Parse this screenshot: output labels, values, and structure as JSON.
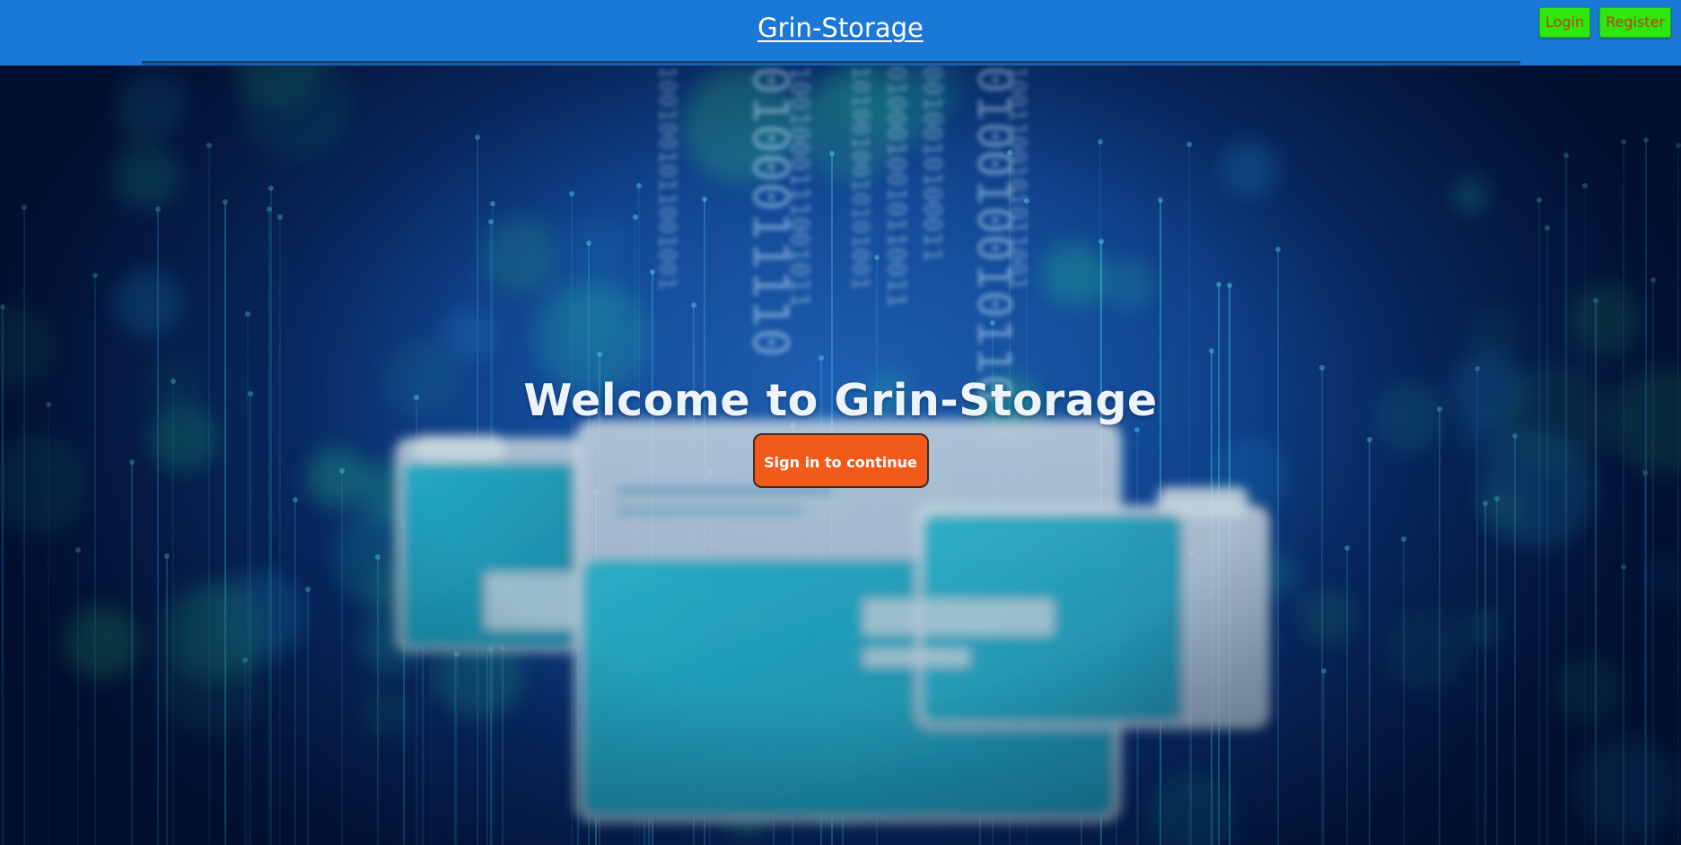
{
  "header": {
    "brand": "Grin-Storage",
    "login_label": "Login",
    "register_label": "Register"
  },
  "hero": {
    "title": "Welcome to Grin-Storage",
    "cta_label": "Sign in to continue"
  },
  "colors": {
    "header_bg": "#1b78d6",
    "auth_button_bg": "#2de80e",
    "auth_button_text": "#c23b10",
    "cta_bg": "#f25a1b"
  },
  "background": {
    "binary_columns": [
      "1001001011001001",
      "0100011110",
      "1001000111001011",
      "1010010010101001",
      "0100010010110011",
      "0010010100011",
      "010010010110",
      "1001100101011001"
    ]
  }
}
